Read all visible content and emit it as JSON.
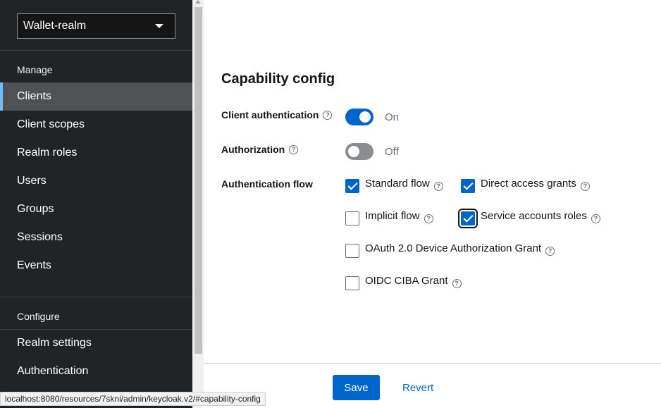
{
  "sidebar": {
    "realm": "Wallet-realm",
    "manage_title": "Manage",
    "manage_items": [
      "Clients",
      "Client scopes",
      "Realm roles",
      "Users",
      "Groups",
      "Sessions",
      "Events"
    ],
    "configure_title": "Configure",
    "configure_items": [
      "Realm settings",
      "Authentication"
    ]
  },
  "main": {
    "heading": "Capability config",
    "client_auth": {
      "label": "Client authentication",
      "state": "On",
      "enabled": true
    },
    "authorization": {
      "label": "Authorization",
      "state": "Off",
      "enabled": false
    },
    "auth_flow": {
      "label": "Authentication flow",
      "options": {
        "standard": {
          "label": "Standard flow",
          "checked": true
        },
        "direct": {
          "label": "Direct access grants",
          "checked": true
        },
        "implicit": {
          "label": "Implicit flow",
          "checked": false
        },
        "service": {
          "label": "Service accounts roles",
          "checked": true
        },
        "device": {
          "label": "OAuth 2.0 Device Authorization Grant",
          "checked": false
        },
        "ciba": {
          "label": "OIDC CIBA Grant",
          "checked": false
        }
      }
    }
  },
  "footer": {
    "save": "Save",
    "revert": "Revert"
  },
  "statusbar": {
    "url": "localhost:8080/resources/7skni/admin/keycloak.v2/#capability-config"
  },
  "colors": {
    "primary": "#0066cc",
    "sidebar_bg": "#212427",
    "nav_active": "#4f5255",
    "active_accent": "#73bcf7"
  },
  "icons": {
    "help": "question-circle-icon",
    "dropdown": "caret-down-icon",
    "check": "checkmark-icon"
  }
}
